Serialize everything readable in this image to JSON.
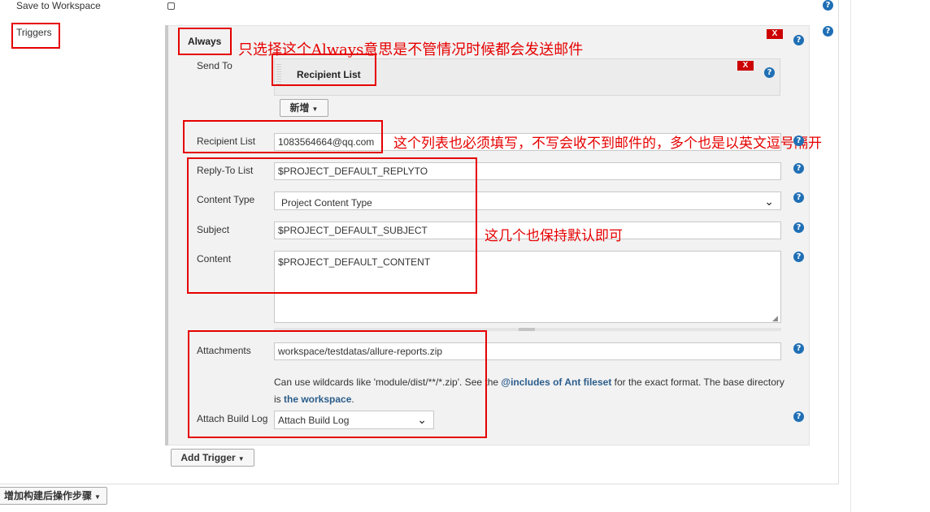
{
  "save_to_workspace": {
    "label": "Save to Workspace",
    "checked": false
  },
  "triggers": {
    "label": "Triggers"
  },
  "trigger": {
    "name": "Always",
    "remove_label": "X"
  },
  "send_to": {
    "label": "Send To",
    "recipient_list_item": "Recipient List",
    "remove_label": "X",
    "add_button": "新增"
  },
  "form": {
    "recipient_list": {
      "label": "Recipient List",
      "value": "1083564664@qq.com"
    },
    "reply_to": {
      "label": "Reply-To List",
      "value": "$PROJECT_DEFAULT_REPLYTO"
    },
    "content_type": {
      "label": "Content Type",
      "value": "Project Content Type"
    },
    "subject": {
      "label": "Subject",
      "value": "$PROJECT_DEFAULT_SUBJECT"
    },
    "content": {
      "label": "Content",
      "value": "$PROJECT_DEFAULT_CONTENT"
    },
    "attachments": {
      "label": "Attachments",
      "value": "workspace/testdatas/allure-reports.zip",
      "hint_part1": "Can use wildcards like 'module/dist/**/*.zip'. See the ",
      "hint_link1": "@includes of Ant fileset",
      "hint_part2": " for the exact format. The base directory",
      "hint_part3": "is ",
      "hint_link2": "the workspace",
      "hint_part4": "."
    },
    "attach_build_log": {
      "label": "Attach Build Log",
      "value": "Attach Build Log"
    }
  },
  "add_trigger_button": "Add Trigger",
  "post_build_button": "增加构建后操作步骤",
  "annotations": {
    "always_note": "只选择这个Always意思是不管情况时候都会发送邮件",
    "recipient_note": "这个列表也必须填写，不写会收不到邮件的，多个也是以英文逗号隔开",
    "defaults_note": "这几个也保持默认即可"
  },
  "colors": {
    "annotation_red": "#e60000",
    "help_blue": "#1f6fb5",
    "remove_red": "#cc0000",
    "link_blue": "#2b5d8c"
  }
}
